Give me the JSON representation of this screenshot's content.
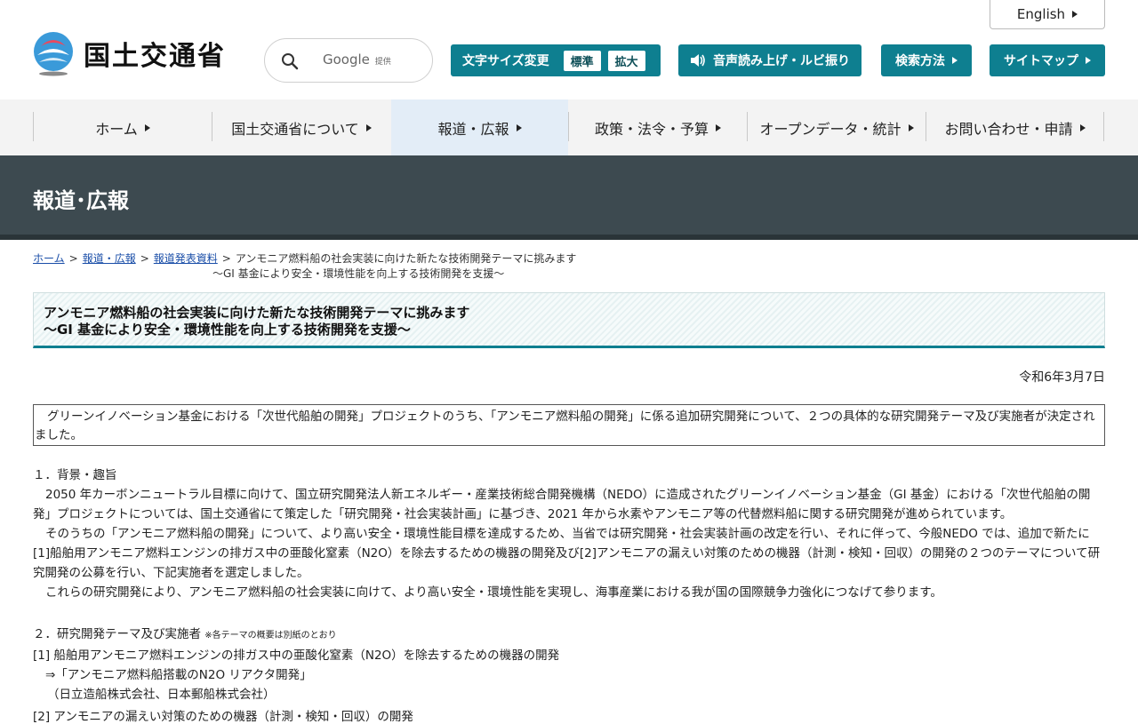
{
  "header": {
    "logo_text": "国土交通省",
    "english_label": "English",
    "search": {
      "brand": "Google",
      "provided": "提供"
    },
    "font_size": {
      "label": "文字サイズ変更",
      "standard": "標準",
      "large": "拡大"
    },
    "voice_label": "音声読み上げ・ルビ振り",
    "howto_label": "検索方法",
    "sitemap_label": "サイトマップ"
  },
  "nav": {
    "items": [
      {
        "label": "ホーム"
      },
      {
        "label": "国土交通省について"
      },
      {
        "label": "報道・広報"
      },
      {
        "label": "政策・法令・予算"
      },
      {
        "label": "オープンデータ・統計"
      },
      {
        "label": "お問い合わせ・申請"
      }
    ]
  },
  "banner": {
    "title": "報道･広報"
  },
  "breadcrumb": {
    "home": "ホーム",
    "press": "報道・広報",
    "release": "報道発表資料",
    "sep": ">",
    "current_line1": "アンモニア燃料船の社会実装に向けた新たな技術開発テーマに挑みます",
    "current_line2": "～GI 基金により安全・環境性能を向上する技術開発を支援～"
  },
  "article": {
    "title_line1": "アンモニア燃料船の社会実装に向けた新たな技術開発テーマに挑みます",
    "title_line2": "～GI 基金により安全・環境性能を向上する技術開発を支援～",
    "date": "令和6年3月7日",
    "lead": "グリーンイノベーション基金における「次世代船舶の開発」プロジェクトのうち、「アンモニア燃料船の開発」に係る追加研究開発について、２つの具体的な研究開発テーマ及び実施者が決定されました。",
    "sec1_heading": "１．背景・趣旨",
    "sec1_p1": "2050 年カーボンニュートラル目標に向けて、国立研究開発法人新エネルギー・産業技術総合開発機構（NEDO）に造成されたグリーンイノベーション基金（GI 基金）における「次世代船舶の開発」プロジェクトについては、国土交通省にて策定した「研究開発・社会実装計画」に基づき、2021 年から水素やアンモニア等の代替燃料船に関する研究開発が進められています。",
    "sec1_p2": "そのうちの「アンモニア燃料船の開発」について、より高い安全・環境性能目標を達成するため、当省では研究開発・社会実装計画の改定を行い、それに伴って、今般NEDO では、追加で新たに[1]船舶用アンモニア燃料エンジンの排ガス中の亜酸化窒素（N2O）を除去するための機器の開発及び[2]アンモニアの漏えい対策のための機器（計測・検知・回収）の開発の２つのテーマについて研究開発の公募を行い、下記実施者を選定しました。",
    "sec1_p3": "これらの研究開発により、アンモニア燃料船の社会実装に向けて、より高い安全・環境性能を実現し、海事産業における我が国の国際競争力強化につなげて参ります。",
    "sec2_heading": "２．研究開発テーマ及び実施者",
    "sec2_note": "※各テーマの概要は別紙のとおり",
    "theme1": "[1] 船舶用アンモニア燃料エンジンの排ガス中の亜酸化窒素（N2O）を除去するための機器の開発",
    "theme1_project": "⇒「アンモニア燃料船搭載のN2O リアクタ開発」",
    "theme1_org": "（日立造船株式会社、日本郵船株式会社）",
    "theme2": "[2] アンモニアの漏えい対策のための機器（計測・検知・回収）の開発"
  },
  "colors": {
    "teal": "#0e7f90",
    "banner": "#3d4a50",
    "link": "#1a4ea8"
  }
}
